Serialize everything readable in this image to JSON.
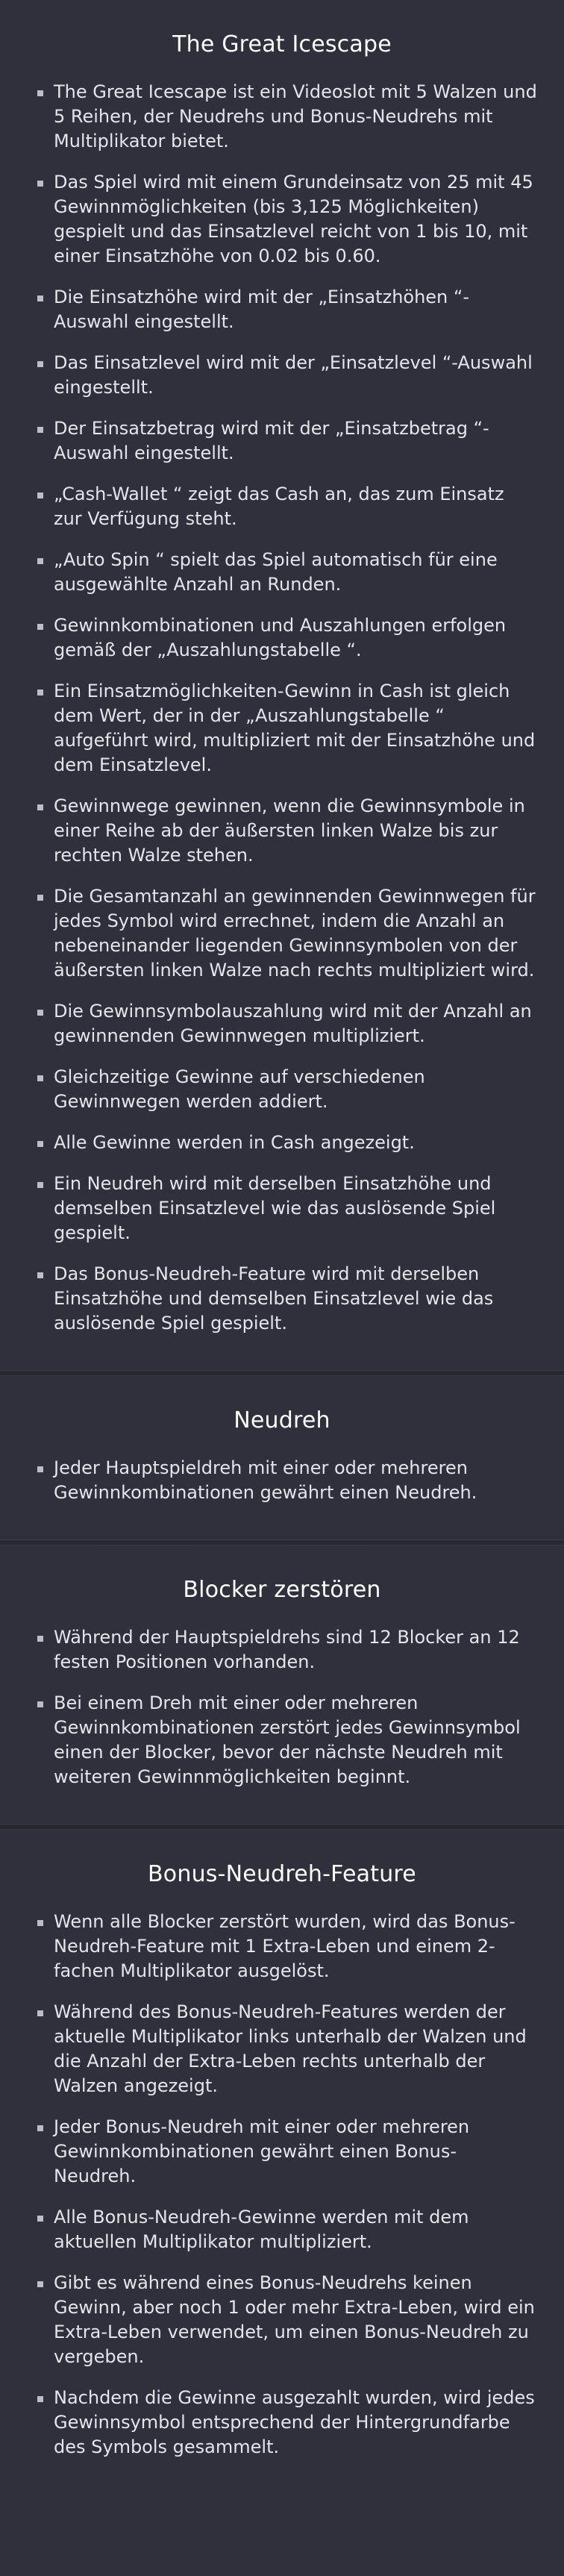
{
  "sections": [
    {
      "title": "The Great Icescape",
      "items": [
        "The Great Icescape ist ein Videoslot mit 5 Walzen und 5 Reihen, der Neudrehs und Bonus-Neudrehs mit Multiplikator bietet.",
        "Das Spiel wird mit einem Grundeinsatz von 25 mit 45 Gewinnmöglichkeiten (bis 3,125 Möglichkeiten) gespielt und das Einsatzlevel reicht von 1 bis 10, mit einer Einsatzhöhe von 0.02 bis 0.60.",
        "Die Einsatzhöhe wird mit der „Einsatzhöhen “-Auswahl eingestellt.",
        "Das Einsatzlevel wird mit der „Einsatzlevel “-Auswahl eingestellt.",
        "Der Einsatzbetrag wird mit der „Einsatzbetrag “-Auswahl eingestellt.",
        "„Cash-Wallet “ zeigt das Cash an, das zum Einsatz zur Verfügung steht.",
        "„Auto Spin “ spielt das Spiel automatisch für eine ausgewählte Anzahl an Runden.",
        "Gewinnkombinationen und Auszahlungen erfolgen gemäß der „Auszahlungstabelle “.",
        "Ein Einsatzmöglichkeiten-Gewinn in Cash ist gleich dem Wert, der in der „Auszahlungstabelle “ aufgeführt wird, multipliziert mit der Einsatzhöhe und dem Einsatzlevel.",
        "Gewinnwege gewinnen, wenn die Gewinnsymbole in einer Reihe ab der äußersten linken Walze bis zur rechten Walze stehen.",
        "Die Gesamtanzahl an gewinnenden Gewinnwegen für jedes Symbol wird errechnet, indem die Anzahl an nebeneinander liegenden Gewinnsymbolen von der äußersten linken Walze nach rechts multipliziert wird.",
        "Die Gewinnsymbolauszahlung wird mit der Anzahl an gewinnenden Gewinnwegen multipliziert.",
        "Gleichzeitige Gewinne auf verschiedenen Gewinnwegen werden addiert.",
        "Alle Gewinne werden in Cash angezeigt.",
        "Ein Neudreh wird mit derselben Einsatzhöhe und demselben Einsatzlevel wie das auslösende Spiel gespielt.",
        "Das Bonus-Neudreh-Feature wird mit derselben Einsatzhöhe und demselben Einsatzlevel wie das auslösende Spiel gespielt."
      ]
    },
    {
      "title": "Neudreh",
      "items": [
        "Jeder Hauptspieldreh mit einer oder mehreren Gewinnkombinationen gewährt einen Neudreh."
      ]
    },
    {
      "title": "Blocker zerstören",
      "items": [
        "Während der Hauptspieldrehs sind 12 Blocker an 12 festen Positionen vorhanden.",
        "Bei einem Dreh mit einer oder mehreren Gewinnkombinationen zerstört jedes Gewinnsymbol einen der Blocker, bevor der nächste Neudreh mit weiteren Gewinnmöglichkeiten beginnt."
      ]
    },
    {
      "title": "Bonus-Neudreh-Feature",
      "items": [
        "Wenn alle Blocker zerstört wurden, wird das Bonus-Neudreh-Feature mit 1 Extra-Leben und einem 2-fachen Multiplikator ausgelöst.",
        "Während des Bonus-Neudreh-Features werden der aktuelle Multiplikator links unterhalb der Walzen und die Anzahl der Extra-Leben rechts unterhalb der Walzen angezeigt.",
        "Jeder Bonus-Neudreh mit einer oder mehreren Gewinnkombinationen gewährt einen Bonus-Neudreh.",
        "Alle Bonus-Neudreh-Gewinne werden mit dem aktuellen Multiplikator multipliziert.",
        "Gibt es während eines Bonus-Neudrehs keinen Gewinn, aber noch 1 oder mehr Extra-Leben, wird ein Extra-Leben verwendet, um einen Bonus-Neudreh zu vergeben.",
        "Nachdem die Gewinne ausgezahlt wurden, wird jedes Gewinnsymbol entsprechend der Hintergrundfarbe des Symbols gesammelt."
      ]
    }
  ]
}
